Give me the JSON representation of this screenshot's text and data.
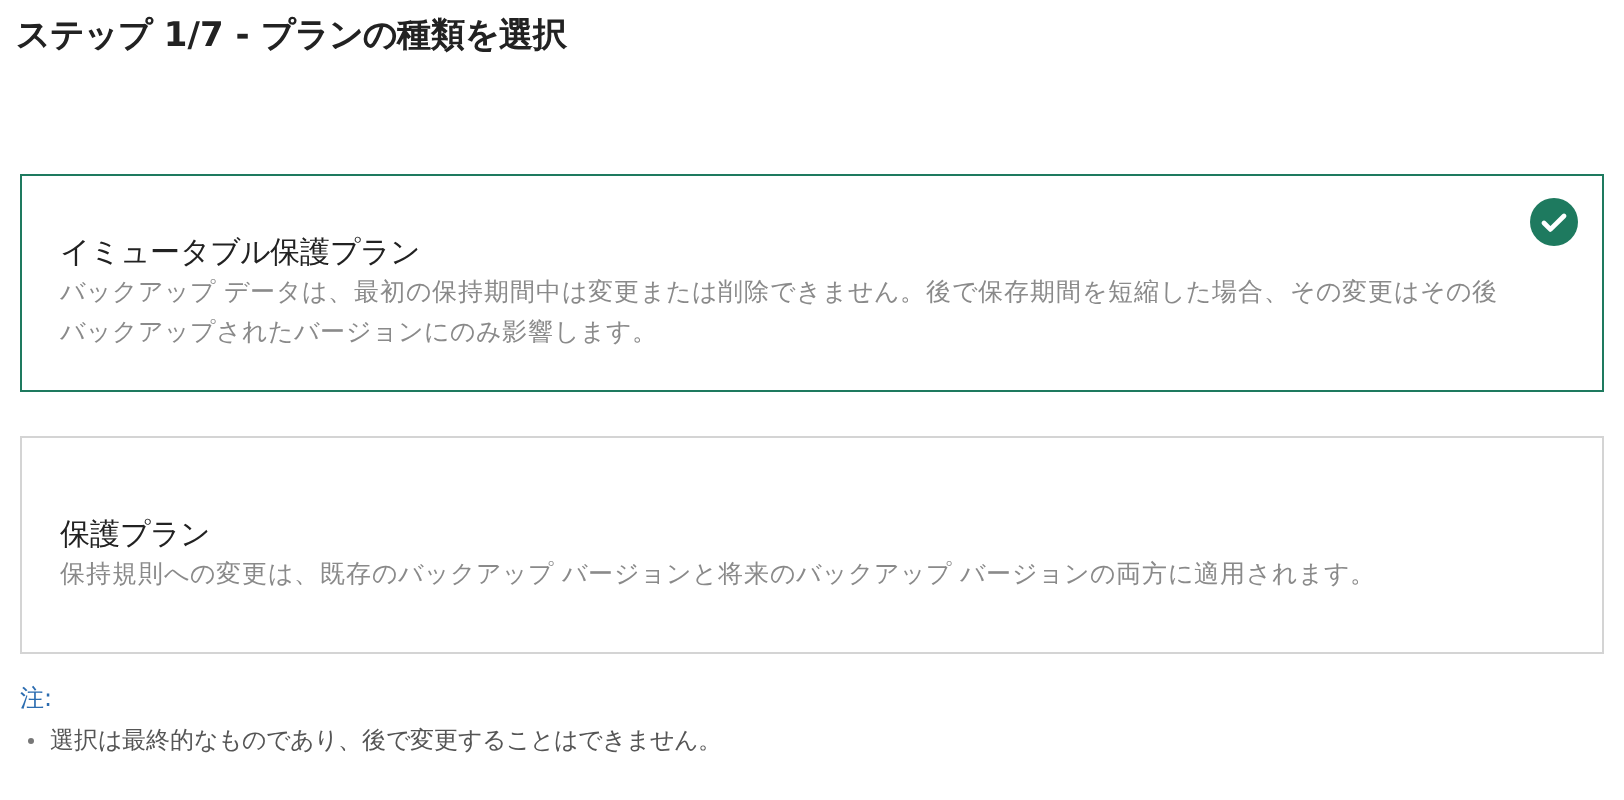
{
  "title": "ステップ 1/7 - プランの種類を選択",
  "plans": [
    {
      "name": "イミュータブル保護プラン",
      "description": "バックアップ データは、最初の保持期間中は変更または削除できません。後で保存期間を短縮した場合、その変更はその後バックアップされたバージョンにのみ影響します。",
      "selected": true
    },
    {
      "name": "保護プラン",
      "description": "保持規則への変更は、既存のバックアップ バージョンと将来のバックアップ バージョンの両方に適用されます。",
      "selected": false
    }
  ],
  "note": {
    "label": "注:",
    "items": [
      "選択は最終的なものであり、後で変更することはできません。"
    ]
  }
}
